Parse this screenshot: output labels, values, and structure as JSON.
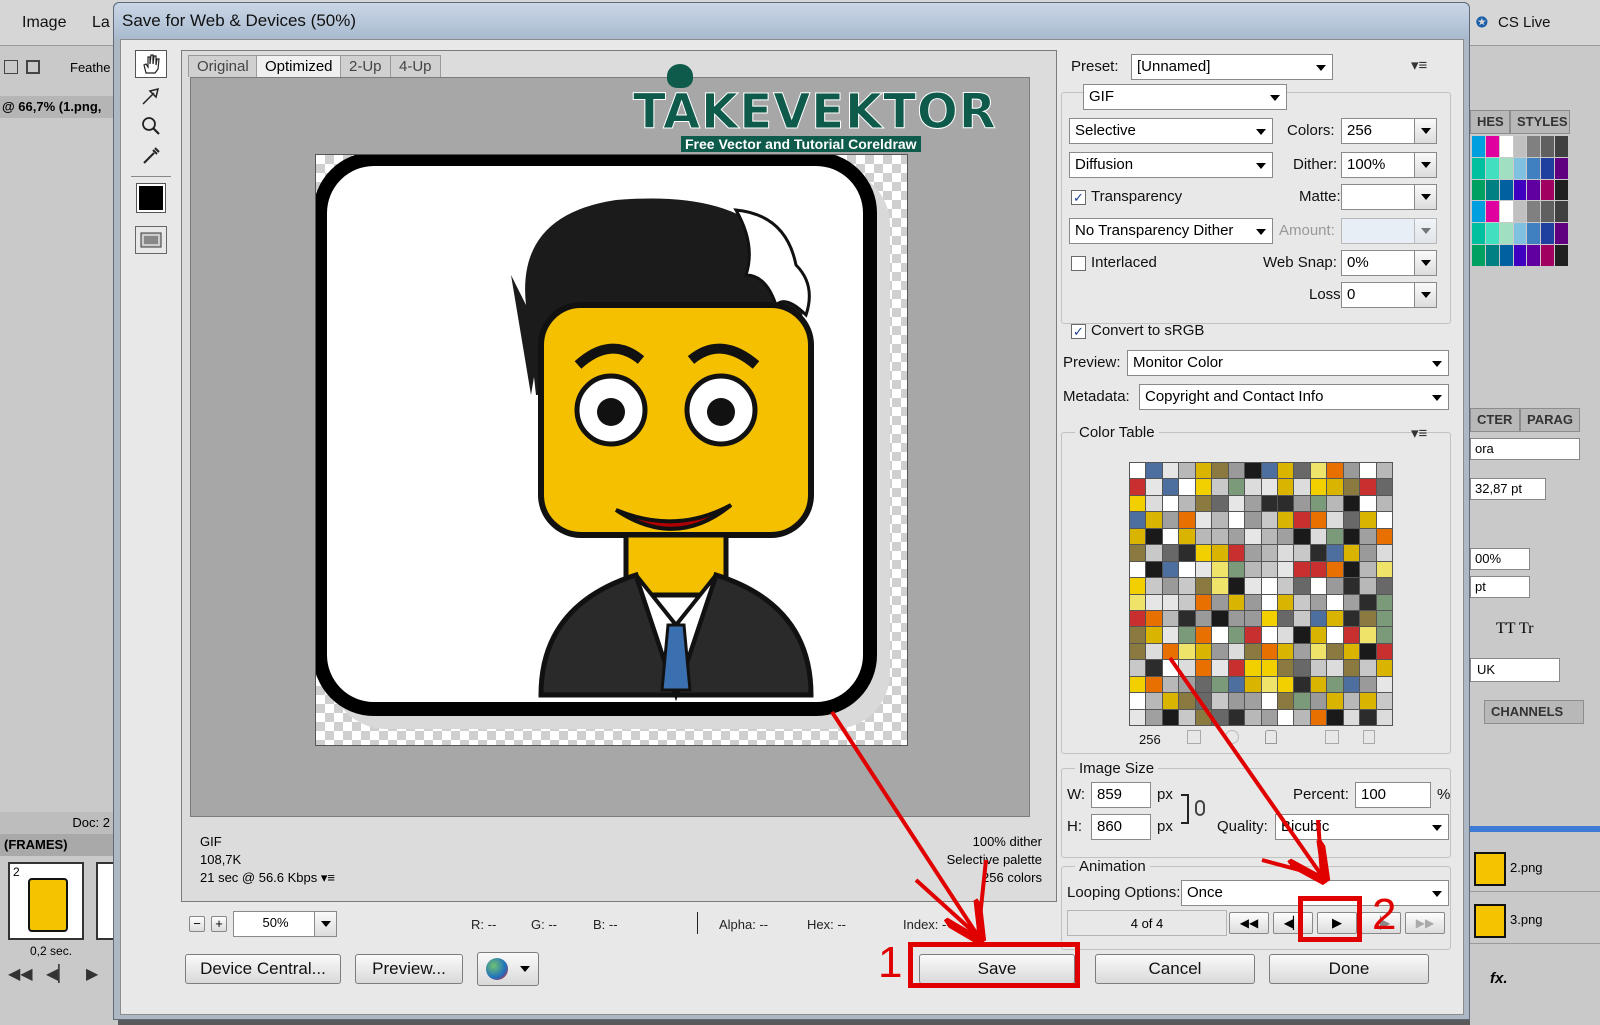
{
  "photoshop": {
    "menu": [
      "Image",
      "La"
    ],
    "options_label": "Feathe",
    "doc_tab": "@ 66,7% (1.png,",
    "doc_status": "Doc: 2",
    "frames_panel_title": "(FRAMES)",
    "frame_number": "2",
    "frame_delay": "0,2 sec.",
    "cs_live": "CS Live",
    "panels": {
      "swatches_tab": "HES",
      "styles_tab": "STYLES",
      "character_tab": "CTER",
      "paragraph_tab": "PARAG",
      "channels_tab": "CHANNELS",
      "font_name": "ora",
      "font_size": "32,87 pt",
      "scale": "00%",
      "tracking": "pt",
      "lang": "UK",
      "layers": [
        "2.png",
        "3.png"
      ]
    }
  },
  "dialog": {
    "title": "Save for Web & Devices (50%)",
    "tabs": [
      "Original",
      "Optimized",
      "2-Up",
      "4-Up"
    ],
    "active_tab": "Optimized",
    "watermark": {
      "brand": "TAKEVEKTOR",
      "tagline": "Free Vector and Tutorial Coreldraw"
    },
    "image_info_left": [
      "GIF",
      "108,7K",
      "21 sec @ 56.6 Kbps"
    ],
    "image_info_right": [
      "100% dither",
      "Selective palette",
      "256 colors"
    ],
    "status": {
      "zoom": "50%",
      "r": "R: --",
      "g": "G: --",
      "b": "B: --",
      "alpha": "Alpha: --",
      "hex": "Hex: --",
      "index": "Index: --"
    },
    "buttons": {
      "device_central": "Device Central...",
      "preview": "Preview...",
      "save": "Save",
      "cancel": "Cancel",
      "done": "Done"
    },
    "settings": {
      "preset_label": "Preset:",
      "preset_value": "[Unnamed]",
      "format": "GIF",
      "reduction": "Selective",
      "colors_label": "Colors:",
      "colors_value": "256",
      "dither_algo": "Diffusion",
      "dither_label": "Dither:",
      "dither_value": "100%",
      "transparency_label": "Transparency",
      "transparency_checked": true,
      "matte_label": "Matte:",
      "transparency_dither": "No Transparency Dither",
      "amount_label": "Amount:",
      "interlaced_label": "Interlaced",
      "interlaced_checked": false,
      "websnap_label": "Web Snap:",
      "websnap_value": "0%",
      "lossy_label": "Lossy:",
      "lossy_value": "0",
      "srgb_label": "Convert to sRGB",
      "srgb_checked": true,
      "preview_label": "Preview:",
      "preview_value": "Monitor Color",
      "metadata_label": "Metadata:",
      "metadata_value": "Copyright and Contact Info",
      "color_table_label": "Color Table",
      "color_count": "256",
      "image_size_label": "Image Size",
      "w_label": "W:",
      "w_value": "859",
      "h_label": "H:",
      "h_value": "860",
      "px": "px",
      "percent_label": "Percent:",
      "percent_value": "100",
      "percent_unit": "%",
      "quality_label": "Quality:",
      "quality_value": "Bicubic",
      "animation_label": "Animation",
      "looping_label": "Looping Options:",
      "looping_value": "Once",
      "frame_counter": "4 of 4"
    }
  },
  "annotations": {
    "step1": "1",
    "step2": "2",
    "color": "#e00000"
  },
  "colors": {
    "dialog_bg": "#e8e8e8",
    "canvas_bg": "#a7a7a7",
    "accent_red": "#e00000",
    "watermark_green": "#0e5b4b"
  }
}
